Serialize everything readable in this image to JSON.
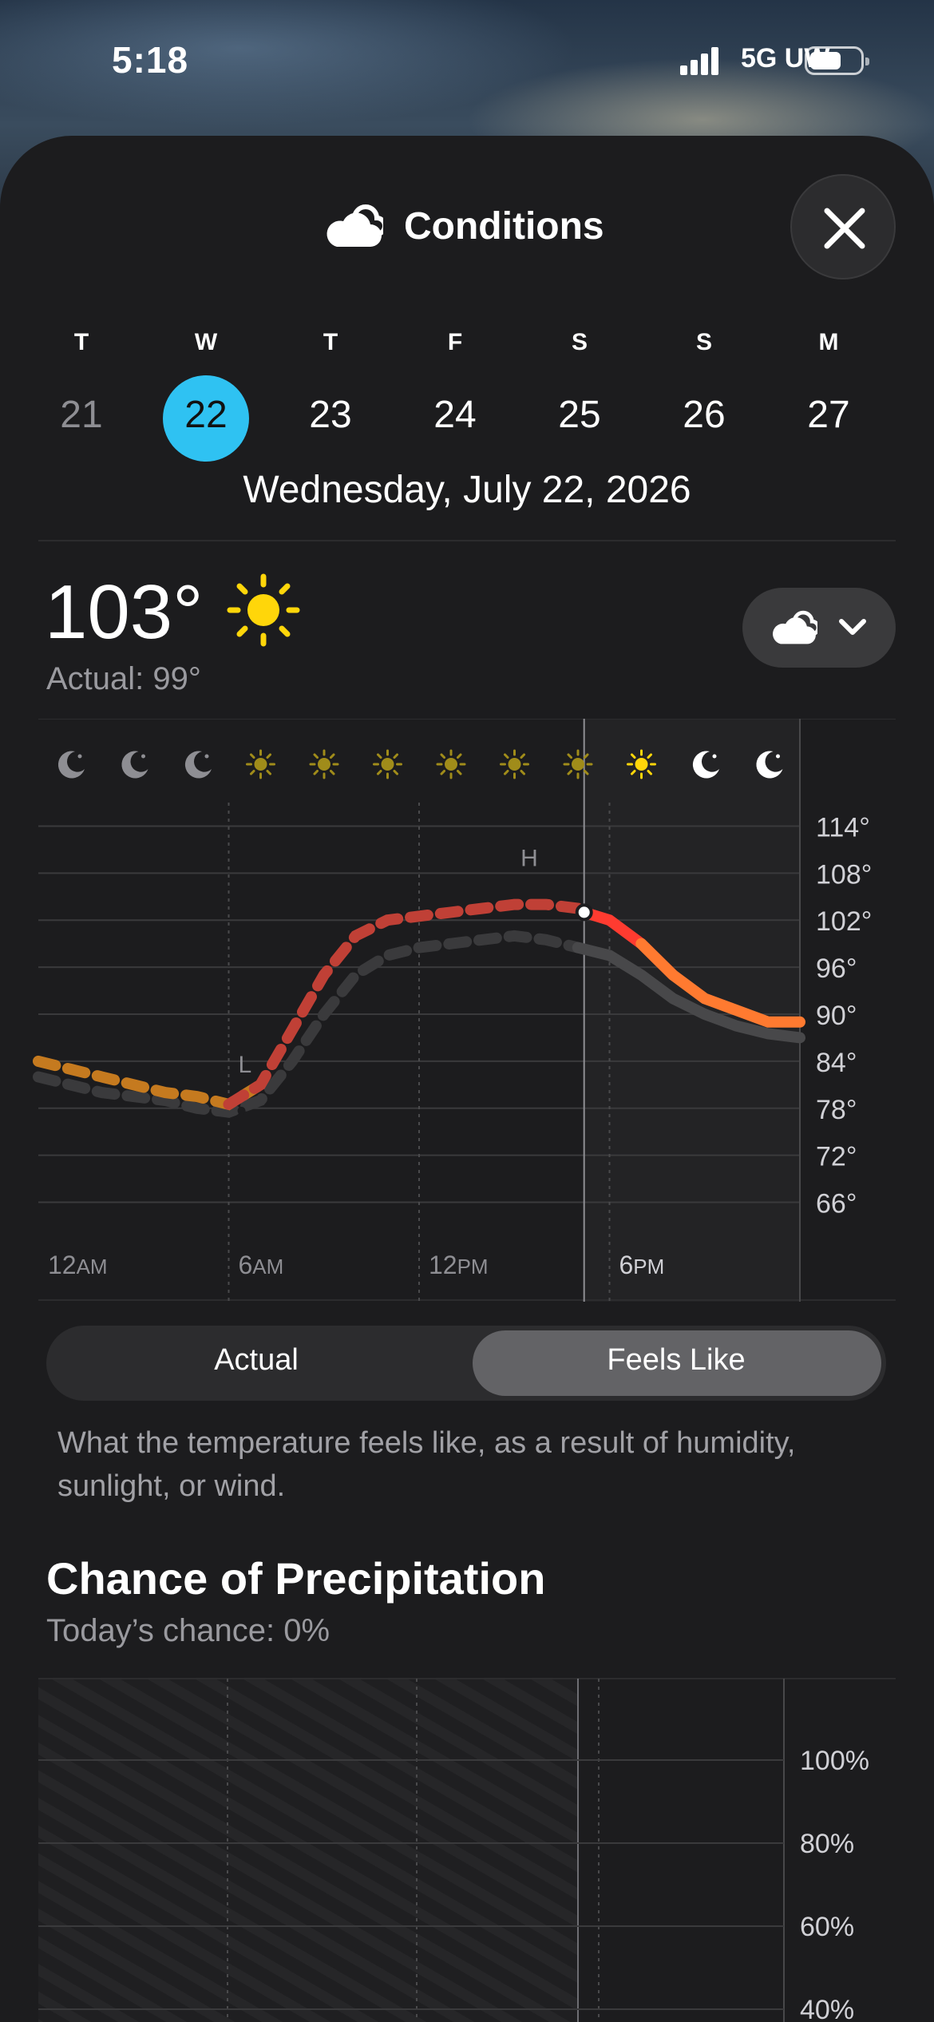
{
  "status_bar": {
    "time": "5:18",
    "network": "5G UW",
    "signal_bars": 4,
    "battery_level": 0.55
  },
  "header": {
    "title": "Conditions",
    "icon": "cloud-icon",
    "close_icon": "close-icon"
  },
  "week": {
    "days": [
      {
        "dow": "T",
        "num": "21",
        "past": true
      },
      {
        "dow": "W",
        "num": "22",
        "selected": true
      },
      {
        "dow": "T",
        "num": "23"
      },
      {
        "dow": "F",
        "num": "24"
      },
      {
        "dow": "S",
        "num": "25"
      },
      {
        "dow": "S",
        "num": "26"
      },
      {
        "dow": "M",
        "num": "27"
      }
    ],
    "selected_date": "Wednesday, July 22, 2026",
    "accent": "#2fc2f2"
  },
  "current": {
    "temp": "103°",
    "condition_icon": "sun-icon",
    "actual_label": "Actual: 99°"
  },
  "layer_button": {
    "icon": "cloud-icon",
    "chevron": "chevron-down-icon"
  },
  "chart_data": {
    "type": "line",
    "x_ticks": [
      "12AM",
      "6AM",
      "12PM",
      "6PM"
    ],
    "y_ticks": [
      "114°",
      "108°",
      "102°",
      "96°",
      "90°",
      "84°",
      "78°",
      "72°",
      "66°"
    ],
    "ylim": [
      63,
      117
    ],
    "hour_icons": [
      "moon-icon",
      "moon-icon",
      "moon-icon",
      "sun-icon",
      "sun-icon",
      "sun-icon",
      "sun-icon",
      "sun-icon",
      "sun-icon",
      "sun-icon",
      "moon-icon",
      "moon-icon"
    ],
    "markers": {
      "high_label": "H",
      "low_label": "L",
      "now_hour": 17.2
    },
    "series": [
      {
        "name": "Feels Like",
        "x": [
          0,
          1,
          2,
          3,
          4,
          5,
          6,
          7,
          8,
          9,
          10,
          11,
          12,
          13,
          14,
          15,
          16,
          17,
          17.2,
          18,
          19,
          20,
          21,
          22,
          23,
          24
        ],
        "y": [
          84,
          83,
          82,
          81,
          80,
          79.5,
          78.5,
          81,
          88,
          95,
          100,
          102,
          102.5,
          103,
          103.5,
          104,
          104,
          103.5,
          103,
          102,
          99,
          95,
          92,
          90.5,
          89,
          89
        ],
        "colors": [
          "#c57a1f",
          "#c04036",
          "#ff3b30",
          "#ff7a30"
        ]
      },
      {
        "name": "Actual",
        "x": [
          0,
          1,
          2,
          3,
          4,
          5,
          6,
          7,
          8,
          9,
          10,
          11,
          12,
          13,
          14,
          15,
          16,
          17,
          18,
          19,
          20,
          21,
          22,
          23,
          24
        ],
        "y": [
          82,
          81,
          80,
          79.5,
          79,
          78,
          77.5,
          79,
          84,
          90,
          95,
          97.5,
          98.5,
          99,
          99.5,
          100,
          99.5,
          98.5,
          97.5,
          95,
          92,
          90,
          88.5,
          87.5,
          87
        ],
        "color": "#3a3a3c"
      }
    ],
    "grid": true
  },
  "toggle": {
    "actual": "Actual",
    "feels_like": "Feels Like",
    "selected": "feels_like"
  },
  "description": "What the temperature feels like, as a result of humidity, sunlight, or wind.",
  "precipitation": {
    "title": "Chance of Precipitation",
    "subtitle": "Today’s chance: 0%",
    "chart_data": {
      "type": "bar",
      "y_ticks": [
        "100%",
        "80%",
        "60%",
        "40%"
      ],
      "ylim": [
        0,
        100
      ],
      "values": [
        0
      ]
    }
  }
}
